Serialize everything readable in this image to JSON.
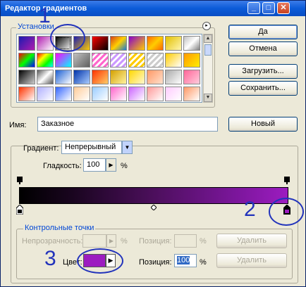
{
  "window": {
    "title": "Редактор градиентов"
  },
  "presets": {
    "label": "Установки",
    "swatches": [
      [
        "linear-gradient(135deg,#1b1bb0,#b01bb0)",
        "linear-gradient(135deg,#b01bb0,#ffffff)",
        "linear-gradient(135deg,#000000,#ffffff)",
        "linear-gradient(135deg,#1b1bb0,#ffcc00)",
        "linear-gradient(135deg,#ff0000,#000000)",
        "linear-gradient(135deg,#d43f1a,#ffd000,#1a7bd4)",
        "linear-gradient(135deg,#8800cc,#ffcc00)",
        "linear-gradient(135deg,#ff6600,#ffcc00,#ff6600)",
        "linear-gradient(135deg,#e2c000,#fff6b0)",
        "linear-gradient(135deg,#c0c0c0,#ffffff,#808080)"
      ],
      [
        "linear-gradient(135deg,#ff0000,#00ff00,#0000ff)",
        "linear-gradient(135deg,#ff0000,#ffff00,#00ff00,#00ffff)",
        "linear-gradient(135deg,#ff00ff,#00ffff)",
        "linear-gradient(135deg,#c0c0c0,#606060)",
        "repeating-linear-gradient(135deg,#ff66cc 0 3px,#ffffff 3px 6px)",
        "repeating-linear-gradient(135deg,#cc99ff 0 3px,#ffffff 3px 6px)",
        "repeating-linear-gradient(135deg,#ffcc00 0 3px,#ffffff 3px 6px)",
        "repeating-linear-gradient(135deg,#cccccc 0 3px,#ffffff 3px 6px)",
        "linear-gradient(135deg,#ffcc00,#ffffff)",
        "linear-gradient(135deg,#ff9900,#ffee00)"
      ],
      [
        "linear-gradient(135deg,#000000,#cccccc)",
        "linear-gradient(135deg,#5a5a5a,#ffffff,#5a5a5a)",
        "linear-gradient(135deg,#1a5fd4,#ffffff)",
        "linear-gradient(135deg,#0033aa,#aaccff)",
        "linear-gradient(135deg,#ff3300,#ffcc66)",
        "linear-gradient(135deg,#d4a000,#fff3a0)",
        "linear-gradient(135deg,#ffd700,#fff8d0)",
        "linear-gradient(135deg,#ff9966,#ffe0cc)",
        "linear-gradient(135deg,#aaaaaa,#ffffff)",
        "linear-gradient(135deg,#ff6699,#ffccdd)"
      ],
      [
        "linear-gradient(135deg,#ff3300,#ffffff)",
        "linear-gradient(135deg,#b0b0ff,#ffffff)",
        "linear-gradient(135deg,#3366ff,#ffffff)",
        "linear-gradient(135deg,#ffcc99,#ffffff)",
        "linear-gradient(135deg,#99ccff,#ffffff)",
        "linear-gradient(135deg,#ff66cc,#ffffff)",
        "linear-gradient(135deg,#cc66ff,#ffffff)",
        "linear-gradient(135deg,#ff9999,#ffffff)",
        "linear-gradient(135deg,#ffccff,#ffffff)",
        "linear-gradient(135deg,#ff9966,#ffffff)"
      ]
    ],
    "selected_index": 2
  },
  "buttons": {
    "ok": "Да",
    "cancel": "Отмена",
    "load": "Загрузить...",
    "save": "Сохранить...",
    "new": "Новый",
    "delete_opacity": "Удалить",
    "delete_color": "Удалить"
  },
  "name": {
    "label": "Имя:",
    "value": "Заказное"
  },
  "gradient": {
    "type_label": "Градиент:",
    "type_value": "Непрерывный",
    "smoothness_label": "Гладкость:",
    "smoothness_value": "100",
    "smoothness_unit": "%",
    "start_color": "#000000",
    "end_color": "#9c1cc0",
    "midpoint": 0.5
  },
  "stops": {
    "label": "Контрольные точки",
    "opacity_label": "Непрозрачность:",
    "opacity_unit": "%",
    "position_label": "Позиция:",
    "position_unit": "%",
    "color_label": "Цвет:",
    "color_value": "#9c1cc0",
    "color_position_label": "Позиция:",
    "color_position_value": "100",
    "color_position_unit": "%"
  },
  "annotations": {
    "one": "1",
    "two": "2",
    "three": "3",
    "color": "#2233bb"
  }
}
